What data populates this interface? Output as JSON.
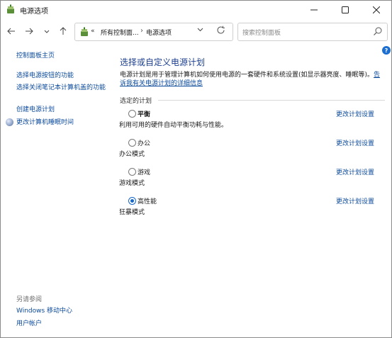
{
  "window": {
    "title": "电源选项"
  },
  "nav": {
    "address_prefix": "«",
    "address_parts": [
      "所有控制面...",
      "电源选项"
    ],
    "address_separator": "›",
    "search_placeholder": "搜索控制面板"
  },
  "sidebar": {
    "links": [
      "控制面板主页",
      "选择电源按钮的功能",
      "选择关闭笔记本计算机盖的功能",
      "创建电源计划",
      "更改计算机睡眠时间"
    ],
    "see_also_title": "另请参阅",
    "see_also": [
      "Windows 移动中心",
      "用户帐户"
    ]
  },
  "main": {
    "title": "选择或自定义电源计划",
    "description": "电源计划是用于管理计算机如何使用电源的一套硬件和系统设置(如显示器亮度、睡眠等)。",
    "description_link": "告诉我有关电源计划的详细信息",
    "section_label": "选定的计划",
    "plans": [
      {
        "name": "平衡",
        "description": "利用可用的硬件自动平衡功耗与性能。",
        "change": "更改计划设置",
        "selected": false
      },
      {
        "name": "办公",
        "description": "办公模式",
        "change": "更改计划设置",
        "selected": false
      },
      {
        "name": "游戏",
        "description": "游戏模式",
        "change": "更改计划设置",
        "selected": false
      },
      {
        "name": "高性能",
        "description": "狂暴模式",
        "change": "更改计划设置",
        "selected": true
      }
    ]
  },
  "colors": {
    "link": "#0b4a9b",
    "title": "#1c3f8f",
    "accent": "#1767c9"
  }
}
